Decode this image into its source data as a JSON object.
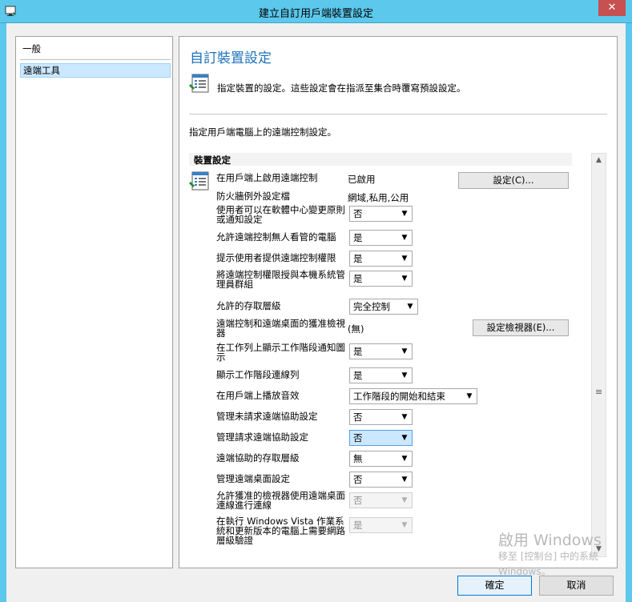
{
  "window": {
    "title": "建立自訂用戶端裝置設定",
    "close_label": "✕"
  },
  "nav": {
    "items": [
      {
        "label": "一般"
      },
      {
        "label": "遠端工具"
      }
    ]
  },
  "main": {
    "title": "自訂裝置設定",
    "description": "指定裝置的設定。這些設定會在指派至集合時覆寫預設設定。",
    "subdescription": "指定用戶端電腦上的遠端控制設定。",
    "section_title": "裝置設定",
    "enable_remote": {
      "label": "在用戶端上啟用遠端控制",
      "value": "已啟用",
      "button": "設定(C)..."
    },
    "firewall": {
      "label": "防火牆例外設定檔",
      "value": "網域,私用,公用"
    },
    "settings": [
      {
        "label": "使用者可以在軟體中心變更原則或通知設定",
        "value": "否"
      },
      {
        "label": "允許遠端控制無人看管的電腦",
        "value": "是"
      },
      {
        "label": "提示使用者提供遠端控制權限",
        "value": "是"
      },
      {
        "label": "將遠端控制權限授與本機系統管理員群組",
        "value": "是"
      },
      {
        "label": "允許的存取層級",
        "value": "完全控制"
      },
      {
        "label": "遠端控制和遠端桌面的獲准檢視器",
        "value": "(無)",
        "button": "設定檢視器(E)..."
      },
      {
        "label": "在工作列上顯示工作階段通知圖示",
        "value": "是"
      },
      {
        "label": "顯示工作階段連線列",
        "value": "是"
      },
      {
        "label": "在用戶端上播放音效",
        "value": "工作階段的開始和結束"
      },
      {
        "label": "管理未請求遠端協助設定",
        "value": "否"
      },
      {
        "label": "管理請求遠端協助設定",
        "value": "否"
      },
      {
        "label": "遠端協助的存取層級",
        "value": "無"
      },
      {
        "label": "管理遠端桌面設定",
        "value": "否"
      },
      {
        "label": "允許獲准的檢視器使用遠端桌面連線進行連線",
        "value": "否"
      },
      {
        "label": "在執行 Windows Vista 作業系統和更新版本的電腦上需要網路層級驗證",
        "value": "是"
      }
    ]
  },
  "watermark": {
    "line1": "啟用 Windows",
    "line2": "移至 [控制台] 中的系統",
    "line3": "Windows。"
  },
  "footer": {
    "ok": "確定",
    "cancel": "取消"
  },
  "icons": {
    "app": "window-app-icon",
    "settings": "settings-list-icon"
  },
  "colors": {
    "titlebar": "#5bc8ec",
    "accent": "#1e73be",
    "selection": "#cce8ff"
  }
}
